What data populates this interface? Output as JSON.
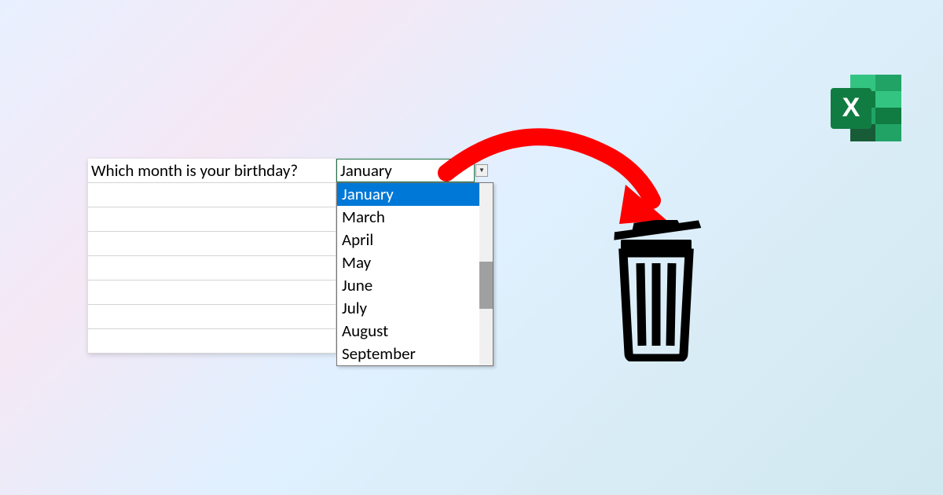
{
  "spreadsheet": {
    "question": "Which month is your birthday?",
    "selected_value": "January",
    "dropdown_options": [
      "January",
      "March",
      "April",
      "May",
      "June",
      "July",
      "August",
      "September"
    ],
    "selected_index": 0
  },
  "icons": {
    "excel": "X"
  }
}
